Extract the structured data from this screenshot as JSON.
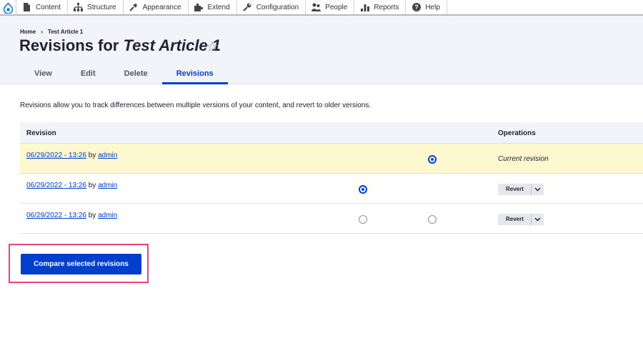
{
  "toolbar": {
    "items": [
      {
        "label": "Content",
        "icon": "content-icon"
      },
      {
        "label": "Structure",
        "icon": "structure-icon"
      },
      {
        "label": "Appearance",
        "icon": "appearance-icon"
      },
      {
        "label": "Extend",
        "icon": "extend-icon"
      },
      {
        "label": "Configuration",
        "icon": "configuration-icon"
      },
      {
        "label": "People",
        "icon": "people-icon"
      },
      {
        "label": "Reports",
        "icon": "reports-icon"
      },
      {
        "label": "Help",
        "icon": "help-icon"
      }
    ]
  },
  "breadcrumb": {
    "home": "Home",
    "separator": "›",
    "current": "Test Article 1"
  },
  "page": {
    "title_prefix": "Revisions for ",
    "title_node": "Test Article 1",
    "star": "☆"
  },
  "tabs": [
    {
      "label": "View",
      "active": false
    },
    {
      "label": "Edit",
      "active": false
    },
    {
      "label": "Delete",
      "active": false
    },
    {
      "label": "Revisions",
      "active": true
    }
  ],
  "description": "Revisions allow you to track differences between multiple versions of your content, and revert to older versions.",
  "table": {
    "headers": {
      "revision": "Revision",
      "operations": "Operations"
    },
    "rows": [
      {
        "date": "06/29/2022 - 13:26",
        "by": " by ",
        "author": "admin",
        "operation": "Current revision"
      },
      {
        "date": "06/29/2022 - 13:26",
        "by": " by ",
        "author": "admin",
        "operation": "Revert"
      },
      {
        "date": "06/29/2022 - 13:26",
        "by": " by ",
        "author": "admin",
        "operation": "Revert"
      }
    ]
  },
  "compare_button": "Compare selected revisions",
  "colors": {
    "accent": "#003ecc",
    "current_row": "#fdf8d0",
    "highlight_box": "#e8457c"
  }
}
